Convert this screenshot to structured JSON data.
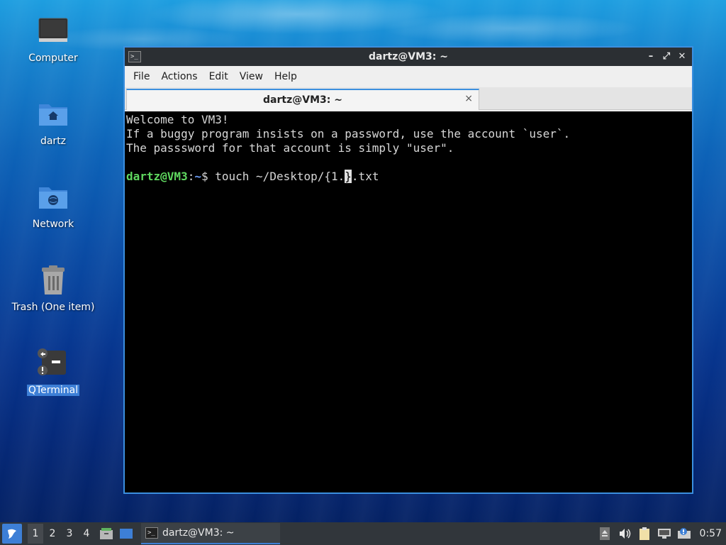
{
  "desktop": {
    "icons": [
      {
        "label": "Computer"
      },
      {
        "label": "dartz"
      },
      {
        "label": "Network"
      },
      {
        "label": "Trash (One item)"
      },
      {
        "label": "QTerminal"
      }
    ]
  },
  "window": {
    "title": "dartz@VM3: ~",
    "menu": [
      "File",
      "Actions",
      "Edit",
      "View",
      "Help"
    ],
    "tab": {
      "label": "dartz@VM3: ~",
      "close": "×"
    },
    "terminal": {
      "lines": [
        "Welcome to VM3!",
        "If a buggy program insists on a password, use the account `user`.",
        "The passsword for that account is simply \"user\".",
        ""
      ],
      "prompt_user": "dartz@VM3",
      "prompt_sep": ":",
      "prompt_path": "~",
      "prompt_symbol": "$ ",
      "command_before_cursor": "touch ~/Desktop/{1.",
      "cursor_char": "}",
      "command_after_cursor": ".txt"
    }
  },
  "taskbar": {
    "workspaces": [
      "1",
      "2",
      "3",
      "4"
    ],
    "active_workspace": "1",
    "task_label": "dartz@VM3: ~",
    "clock": "0:57"
  },
  "colors": {
    "accent": "#3d7fd6",
    "prompt_user": "#5fd75f",
    "prompt_path": "#6c9ef8"
  }
}
